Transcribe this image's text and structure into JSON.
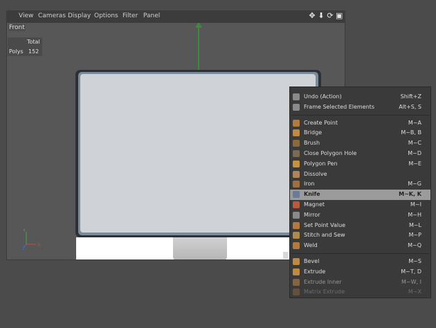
{
  "menubar": {
    "items": [
      "View",
      "Cameras",
      "Display",
      "Options",
      "Filter",
      "Panel"
    ],
    "icons": [
      "move-view-icon",
      "move-down-icon",
      "rotate-view-icon",
      "maximize-view-icon"
    ]
  },
  "viewport": {
    "label": "Front",
    "stats": {
      "header": "Total",
      "row_label": "Polys",
      "row_value": "152"
    }
  },
  "axes": {
    "x": "X",
    "y": "Y",
    "z": "Z"
  },
  "context_menu": {
    "groups": [
      [
        {
          "label": "Undo (Action)",
          "shortcut": "Shift+Z",
          "icon": "undo-icon",
          "color": "#8a8a8a"
        },
        {
          "label": "Frame Selected Elements",
          "shortcut": "Alt+S, S",
          "icon": "frame-icon",
          "color": "#8a8a8a"
        }
      ],
      [
        {
          "label": "Create Point",
          "shortcut": "M~A",
          "icon": "create-point-icon",
          "color": "#b27a3c"
        },
        {
          "label": "Bridge",
          "shortcut": "M~B, B",
          "icon": "bridge-icon",
          "color": "#c08a44"
        },
        {
          "label": "Brush",
          "shortcut": "M~C",
          "icon": "brush-icon",
          "color": "#8a6a3c"
        },
        {
          "label": "Close Polygon Hole",
          "shortcut": "M~D",
          "icon": "close-hole-icon",
          "color": "#7c6a54"
        },
        {
          "label": "Polygon Pen",
          "shortcut": "M~E",
          "icon": "polygon-pen-icon",
          "color": "#c79240"
        },
        {
          "label": "Dissolve",
          "shortcut": "",
          "icon": "dissolve-icon",
          "color": "#b0835a"
        },
        {
          "label": "Iron",
          "shortcut": "M~G",
          "icon": "iron-icon",
          "color": "#a0703c"
        },
        {
          "label": "Knife",
          "shortcut": "M~K, K",
          "icon": "knife-icon",
          "color": "#6a7a9a",
          "active": true
        },
        {
          "label": "Magnet",
          "shortcut": "M~I",
          "icon": "magnet-icon",
          "color": "#b85a3c"
        },
        {
          "label": "Mirror",
          "shortcut": "M~H",
          "icon": "mirror-icon",
          "color": "#8a8a8a"
        },
        {
          "label": "Set Point Value",
          "shortcut": "M~L",
          "icon": "set-point-icon",
          "color": "#b27a3c"
        },
        {
          "label": "Stitch and Sew",
          "shortcut": "M~P",
          "icon": "stitch-icon",
          "color": "#b08a4a"
        },
        {
          "label": "Weld",
          "shortcut": "M~Q",
          "icon": "weld-icon",
          "color": "#b27a3c"
        }
      ],
      [
        {
          "label": "Bevel",
          "shortcut": "M~S",
          "icon": "bevel-icon",
          "color": "#c08a44"
        },
        {
          "label": "Extrude",
          "shortcut": "M~T, D",
          "icon": "extrude-icon",
          "color": "#c08a44"
        },
        {
          "label": "Extrude Inner",
          "shortcut": "M~W, I",
          "icon": "extrude-inner-icon",
          "color": "#c08a44",
          "fade": 1
        },
        {
          "label": "Matrix Extrude",
          "shortcut": "M~X",
          "icon": "matrix-extrude-icon",
          "color": "#c08a44",
          "fade": 2
        }
      ]
    ]
  }
}
